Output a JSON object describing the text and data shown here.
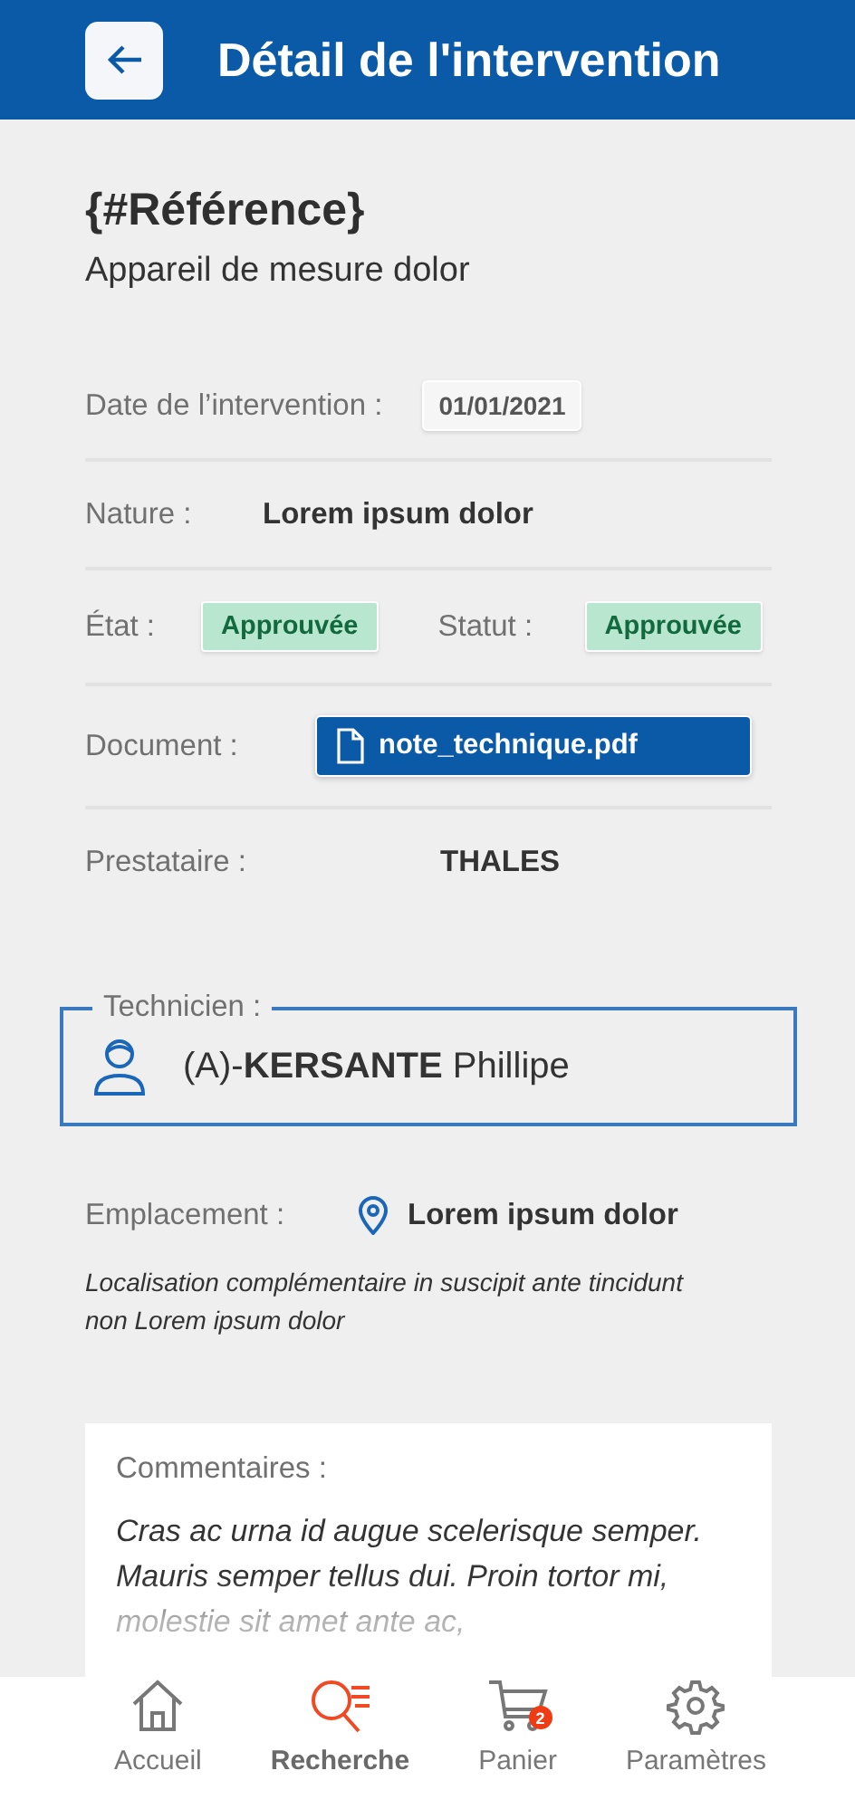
{
  "header": {
    "title": "Détail de l'intervention"
  },
  "reference": "{#Référence}",
  "subtitle": "Appareil de mesure dolor",
  "date": {
    "label": "Date de l’intervention :",
    "value": "01/01/2021"
  },
  "nature": {
    "label": "Nature :",
    "value": "Lorem ipsum dolor"
  },
  "etat": {
    "label": "État :",
    "value": "Approuvée"
  },
  "statut": {
    "label": "Statut :",
    "value": "Approuvée"
  },
  "document": {
    "label": "Document :",
    "file": "note_technique.pdf"
  },
  "prestataire": {
    "label": "Prestataire :",
    "value": "THALES"
  },
  "technicien": {
    "label": "Technicien :",
    "name": "(A)-**KERSANTE** Phillipe"
  },
  "emplacement": {
    "label": "Emplacement :",
    "value": "Lorem ipsum dolor",
    "detail": "Localisation complémentaire in suscipit ante tincidunt non Lorem ipsum dolor"
  },
  "comments": {
    "label": "Commentaires :",
    "text": "Cras ac urna id augue scelerisque semper. Mauris semper tellus dui. Proin tortor mi, molestie sit amet ante ac,"
  },
  "nav": [
    {
      "kind": "home",
      "label": "Accueil",
      "selected": false
    },
    {
      "kind": "search",
      "label": "Recherche",
      "selected": true
    },
    {
      "kind": "cart",
      "label": "Panier",
      "selected": false,
      "badge": "2"
    },
    {
      "kind": "settings",
      "label": "Paramètres",
      "selected": false
    }
  ]
}
